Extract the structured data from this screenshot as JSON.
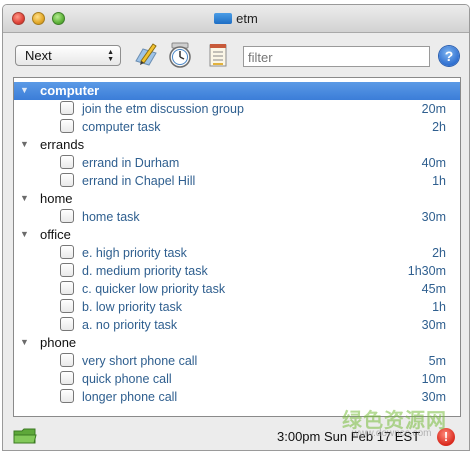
{
  "window": {
    "title": "etm"
  },
  "toolbar": {
    "view_select": "Next",
    "filter_placeholder": "filter",
    "help_label": "?"
  },
  "groups": [
    {
      "name": "computer",
      "selected": true,
      "tasks": [
        {
          "label": "join the etm discussion group",
          "duration": "20m"
        },
        {
          "label": "computer task",
          "duration": "2h"
        }
      ]
    },
    {
      "name": "errands",
      "tasks": [
        {
          "label": "errand in Durham",
          "duration": "40m"
        },
        {
          "label": "errand in Chapel Hill",
          "duration": "1h"
        }
      ]
    },
    {
      "name": "home",
      "tasks": [
        {
          "label": "home task",
          "duration": "30m"
        }
      ]
    },
    {
      "name": "office",
      "tasks": [
        {
          "label": "e. high priority task",
          "duration": "2h"
        },
        {
          "label": "d. medium priority task",
          "duration": "1h30m"
        },
        {
          "label": "c. quicker low priority task",
          "duration": "45m"
        },
        {
          "label": "b. low priority task",
          "duration": "1h"
        },
        {
          "label": "a. no priority task",
          "duration": "30m"
        }
      ]
    },
    {
      "name": "phone",
      "tasks": [
        {
          "label": "very short phone call",
          "duration": "5m"
        },
        {
          "label": "quick phone call",
          "duration": "10m"
        },
        {
          "label": "longer phone call",
          "duration": "30m"
        }
      ]
    }
  ],
  "status": {
    "datetime": "3:00pm Sun Feb 17 EST",
    "alert_label": "!"
  },
  "watermark": {
    "text": "绿色资源网",
    "sub": "www.downcc.com"
  },
  "icons": {
    "toolbar": [
      "pencil-icon",
      "clock-icon",
      "notepad-icon"
    ],
    "status": [
      "folder-icon",
      "alert-icon"
    ]
  }
}
